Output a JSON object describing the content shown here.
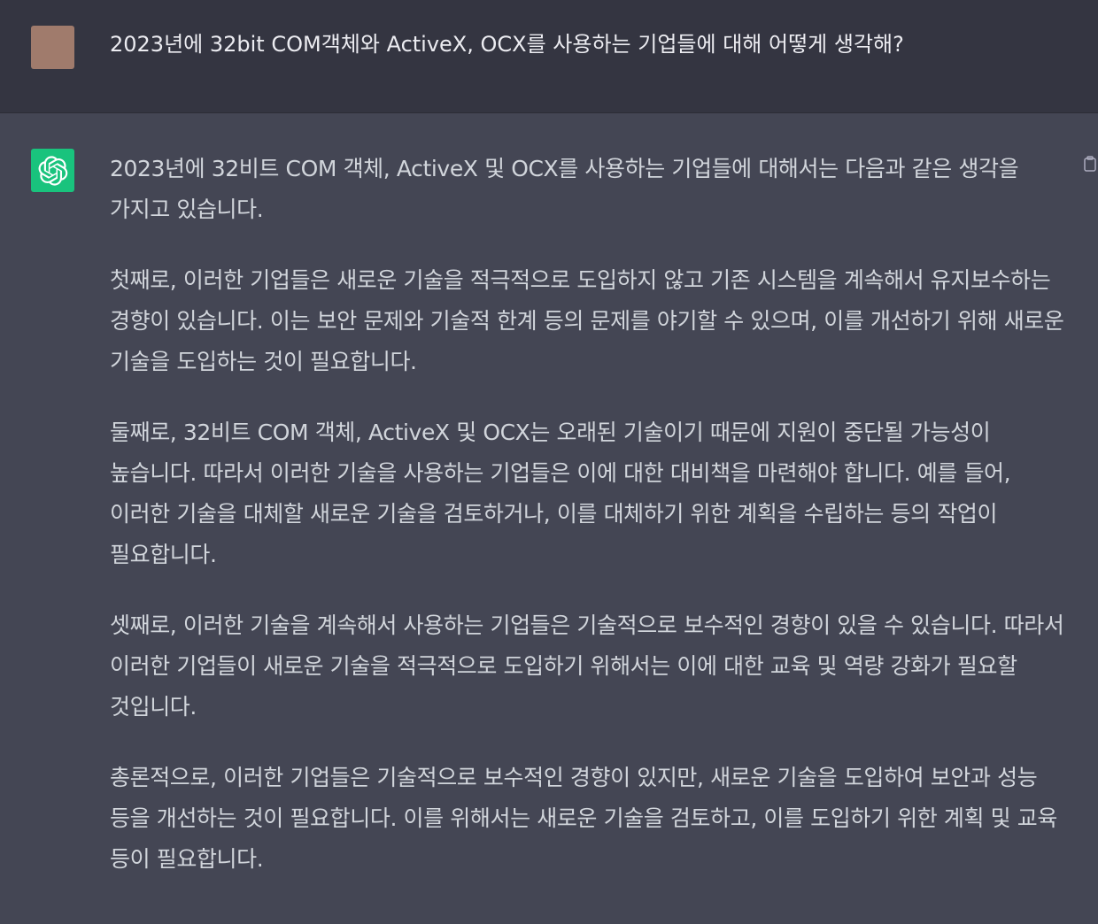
{
  "user_message": {
    "text": "2023년에 32bit COM객체와 ActiveX, OCX를 사용하는 기업들에 대해 어떻게 생각해?"
  },
  "assistant_message": {
    "paragraphs": [
      "2023년에 32비트 COM 객체, ActiveX 및 OCX를 사용하는 기업들에 대해서는 다음과 같은 생각을 가지고 있습니다.",
      "첫째로, 이러한 기업들은 새로운 기술을 적극적으로 도입하지 않고 기존 시스템을 계속해서 유지보수하는 경향이 있습니다. 이는 보안 문제와 기술적 한계 등의 문제를 야기할 수 있으며, 이를 개선하기 위해 새로운 기술을 도입하는 것이 필요합니다.",
      "둘째로, 32비트 COM 객체, ActiveX 및 OCX는 오래된 기술이기 때문에 지원이 중단될 가능성이 높습니다. 따라서 이러한 기술을 사용하는 기업들은 이에 대한 대비책을 마련해야 합니다. 예를 들어, 이러한 기술을 대체할 새로운 기술을 검토하거나, 이를 대체하기 위한 계획을 수립하는 등의 작업이 필요합니다.",
      "셋째로, 이러한 기술을 계속해서 사용하는 기업들은 기술적으로 보수적인 경향이 있을 수 있습니다. 따라서 이러한 기업들이 새로운 기술을 적극적으로 도입하기 위해서는 이에 대한 교육 및 역량 강화가 필요할 것입니다.",
      "총론적으로, 이러한 기업들은 기술적으로 보수적인 경향이 있지만, 새로운 기술을 도입하여 보안과 성능 등을 개선하는 것이 필요합니다. 이를 위해서는 새로운 기술을 검토하고, 이를 도입하기 위한 계획 및 교육 등이 필요합니다."
    ]
  },
  "icons": {
    "user_avatar": "user-avatar",
    "assistant_avatar": "openai-logo-icon",
    "copy": "copy-icon"
  },
  "colors": {
    "user_bg": "#343541",
    "assistant_bg": "#444654",
    "avatar_green": "#19c37d",
    "user_avatar": "#a07b6c"
  }
}
